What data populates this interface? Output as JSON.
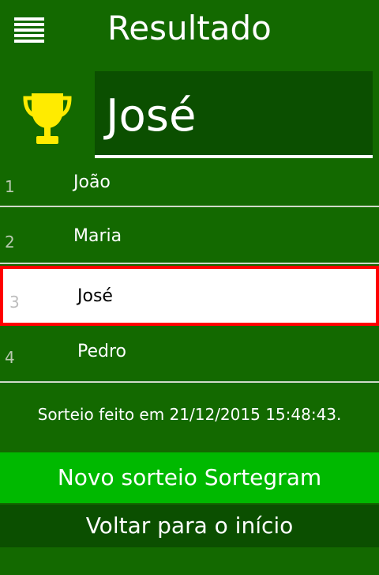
{
  "header": {
    "title": "Resultado",
    "menu_icon": "hamburger-menu-icon",
    "trophy_icon": "trophy-icon",
    "winner": "José"
  },
  "results": [
    {
      "index": "1",
      "name": "João"
    },
    {
      "index": "2",
      "name": "Maria"
    },
    {
      "index": "3",
      "name": "José"
    },
    {
      "index": "4",
      "name": "Pedro"
    }
  ],
  "info_text": "Sorteio feito em 21/12/2015 15:48:43.",
  "buttons": {
    "new_draw": "Novo sorteio Sortegram",
    "back_home": "Voltar para o início"
  },
  "colors": {
    "background": "#136900",
    "dark_green": "#0b4f00",
    "bright_green": "#00b900",
    "selected_border": "#ff0000",
    "trophy": "#ffeb00"
  }
}
